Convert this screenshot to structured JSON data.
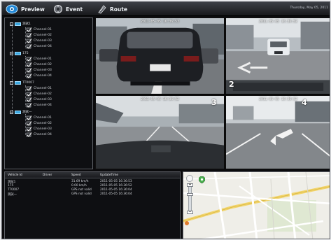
{
  "nav": {
    "preview_label": "Preview",
    "event_label": "Event",
    "route_label": "Route",
    "date_text": "Thursday, May 05, 2011"
  },
  "tree": {
    "groups": [
      {
        "name": "測試1",
        "channels": [
          "Channel-01",
          "Channel-02",
          "Channel-03",
          "Channel-04"
        ]
      },
      {
        "name": "175",
        "channels": [
          "Channel-01",
          "Channel-02",
          "Channel-03",
          "Channel-04"
        ]
      },
      {
        "name": "TT0007",
        "channels": [
          "Channel-01",
          "Channel-02",
          "Channel-03",
          "Channel-04"
        ]
      },
      {
        "name": "測試一",
        "channels": [
          "Channel-01",
          "Channel-02",
          "Channel-03",
          "Channel-04"
        ]
      }
    ]
  },
  "cameras": [
    {
      "time": "2011-05-05 16:36:53",
      "number": ""
    },
    {
      "time": "2011-05-05 16:36:52",
      "number": "2"
    },
    {
      "time": "2011-05-05 16:36:52",
      "number": "3"
    },
    {
      "time": "2011-05-05 16:36:52",
      "number": "4"
    }
  ],
  "vehicle_list": {
    "headers": [
      "Vehicle Id",
      "Driver",
      "Speed",
      "UpdateTime"
    ],
    "rows": [
      {
        "id": "測試1",
        "driver": "",
        "speed": "31.69 km/h",
        "time": "2011-05-05 16:36:53"
      },
      {
        "id": "175",
        "driver": "",
        "speed": "0.00 km/h",
        "time": "2011-05-05 16:36:52"
      },
      {
        "id": "TT0007",
        "driver": "",
        "speed": "GPS not valid",
        "time": "2011-05-05 16:36:04"
      },
      {
        "id": "測試一",
        "driver": "",
        "speed": "GPS not valid",
        "time": "2011-05-05 16:36:04"
      }
    ]
  },
  "colors": {
    "accent": "#3aa7e0",
    "map_road": "#ffffff",
    "map_highlight_road": "#f2d46a"
  }
}
